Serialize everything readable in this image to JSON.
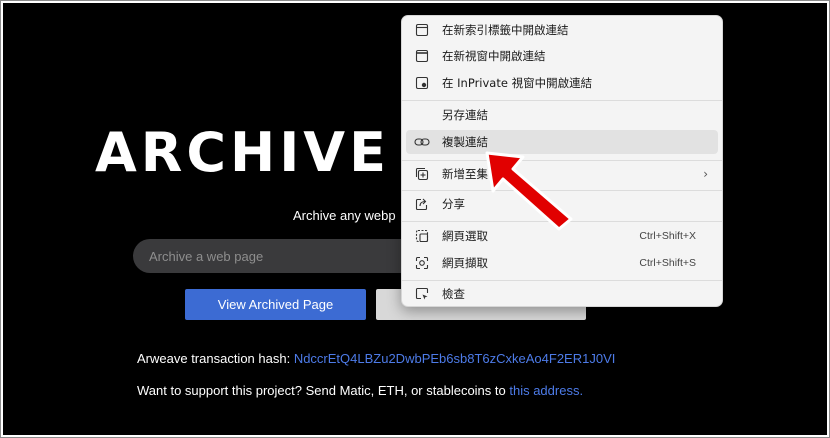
{
  "page": {
    "hero_title": "ARCHIVE P",
    "tagline": "Archive any webp",
    "search": {
      "placeholder": "Archive a web page"
    },
    "view_button": "View Archived Page",
    "hash": {
      "label": "Arweave transaction hash: ",
      "value": "NdccrEtQ4LBZu2DwbPEb6sb8T6zCxkeAo4F2ER1J0VI"
    },
    "support": {
      "text": "Want to support this project? Send Matic, ETH, or stablecoins to ",
      "link": "this address."
    }
  },
  "context_menu": {
    "items": [
      {
        "label": "在新索引標籤中開啟連結",
        "icon": "new-tab-icon"
      },
      {
        "label": "在新視窗中開啟連結",
        "icon": "new-window-icon"
      },
      {
        "label": "在 InPrivate 視窗中開啟連結",
        "icon": "inprivate-icon"
      },
      {
        "label": "另存連結",
        "icon": ""
      },
      {
        "label": "複製連結",
        "icon": "link-icon"
      },
      {
        "label": "新增至集",
        "icon": "collections-icon"
      },
      {
        "label": "分享",
        "icon": "share-icon"
      },
      {
        "label": "網頁選取",
        "icon": "web-select-icon",
        "shortcut": "Ctrl+Shift+X"
      },
      {
        "label": "網頁擷取",
        "icon": "web-capture-icon",
        "shortcut": "Ctrl+Shift+S"
      },
      {
        "label": "檢查",
        "icon": "inspect-icon"
      }
    ]
  },
  "colors": {
    "background": "#000000",
    "accent": "#3c6bd3",
    "link": "#4d7be8",
    "arrow": "#e10000"
  }
}
